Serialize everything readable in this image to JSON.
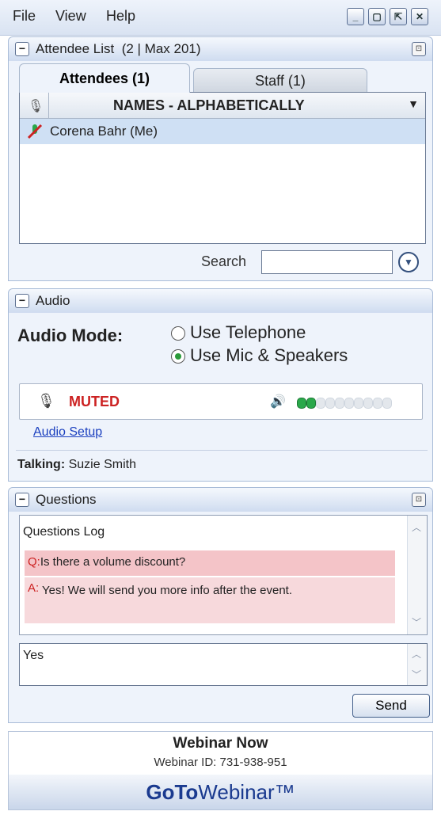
{
  "menu": {
    "file": "File",
    "view": "View",
    "help": "Help"
  },
  "window_controls": [
    "minimize",
    "restore",
    "grab-tab",
    "close"
  ],
  "attendee_panel": {
    "title": "Attendee List",
    "count": "(2 | Max 201)",
    "tabs": [
      {
        "label": "Attendees (1)",
        "active": true
      },
      {
        "label": "Staff (1)",
        "active": false
      }
    ],
    "list_header": "NAMES - ALPHABETICALLY",
    "attendees": [
      {
        "name": "Corena Bahr (Me)",
        "mic": "muted"
      }
    ],
    "search_label": "Search",
    "search_value": ""
  },
  "audio_panel": {
    "title": "Audio",
    "mode_label": "Audio Mode:",
    "options": [
      {
        "label": "Use Telephone",
        "selected": false
      },
      {
        "label": "Use Mic & Speakers",
        "selected": true
      }
    ],
    "status": "MUTED",
    "meter_level_fraction": 0.2,
    "meter_segments": 10,
    "setup_link": "Audio Setup",
    "talking_label": "Talking:",
    "talking_name": "Suzie Smith"
  },
  "questions_panel": {
    "title": "Questions",
    "log_title": "Questions Log",
    "question_prefix": "Q:",
    "question": "Is there a volume discount?",
    "answer_prefix": "A:",
    "answer": "Yes! We will send you more info after the event.",
    "reply_text": "Yes",
    "send_label": "Send"
  },
  "footer": {
    "title": "Webinar Now",
    "webinar_id": "Webinar ID: 731-938-951",
    "brand_bold": "GoTo",
    "brand_light": "Webinar™"
  },
  "colors": {
    "muted_red": "#cc2222",
    "meter_green": "#2aa84a",
    "accent_blue": "#1a3a8f"
  }
}
